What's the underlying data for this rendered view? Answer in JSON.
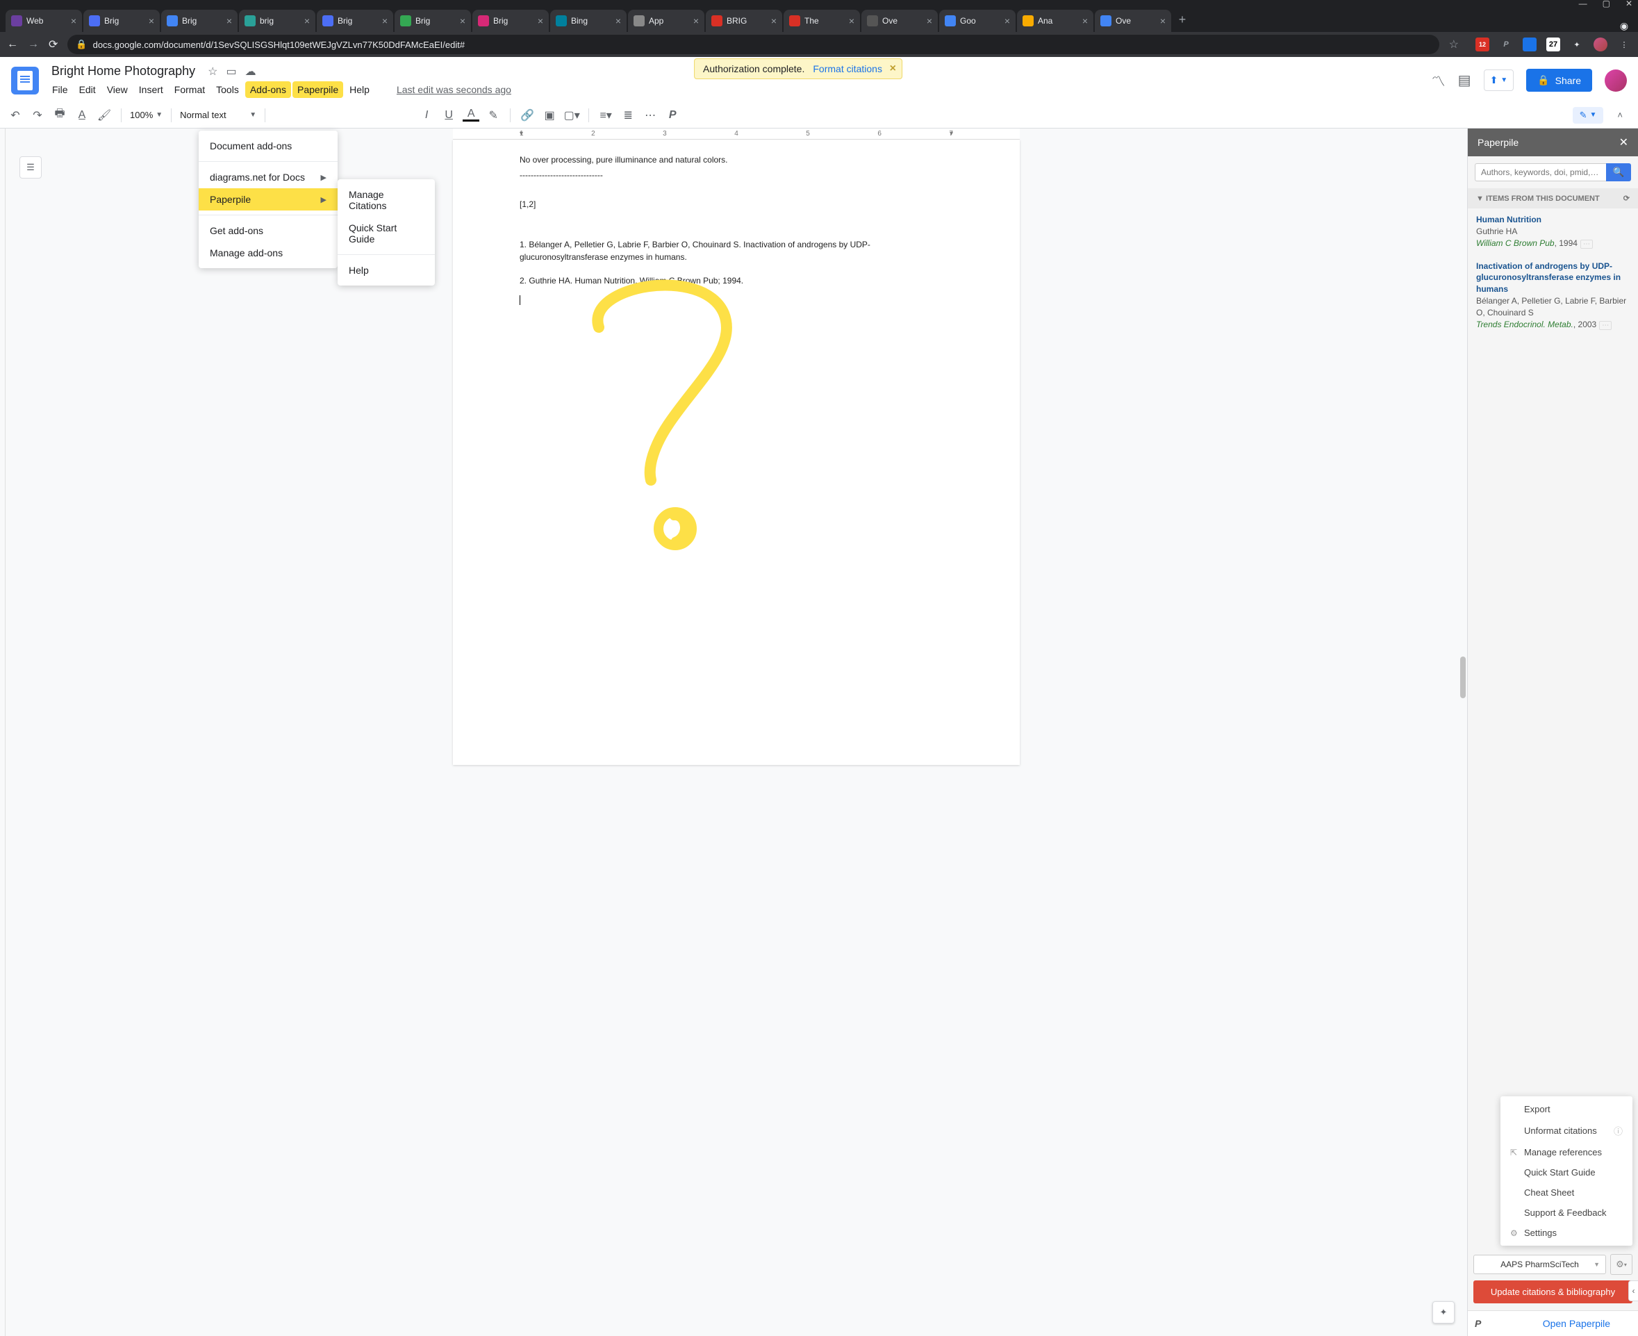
{
  "chrome": {
    "win_controls": [
      "—",
      "▢",
      "✕"
    ],
    "tabs": [
      {
        "title": "Web",
        "fav": "#6b3fa0"
      },
      {
        "title": "Brig",
        "fav": "#4c6ef5"
      },
      {
        "title": "Brig",
        "fav": "#4285f4",
        "active": true
      },
      {
        "title": "brig",
        "fav": "#2aa198"
      },
      {
        "title": "Brig",
        "fav": "#4c6ef5"
      },
      {
        "title": "Brig",
        "fav": "#34a853"
      },
      {
        "title": "Brig",
        "fav": "#d62976"
      },
      {
        "title": "Bing",
        "fav": "#00809d"
      },
      {
        "title": "App",
        "fav": "#888"
      },
      {
        "title": "BRIG",
        "fav": "#d93025"
      },
      {
        "title": "The",
        "fav": "#d93025"
      },
      {
        "title": "Ove",
        "fav": "#555"
      },
      {
        "title": "Goo",
        "fav": "#4285f4"
      },
      {
        "title": "Ana",
        "fav": "#f9ab00"
      },
      {
        "title": "Ove",
        "fav": "#4285f4"
      }
    ],
    "url": "docs.google.com/document/d/1SevSQLISGSHlqt109etWEJgVZLvn77K50DdFAMcEaEI/edit#",
    "ext_badge": "12",
    "ext_num": "27"
  },
  "docs": {
    "title": "Bright Home Photography",
    "menus": [
      "File",
      "Edit",
      "View",
      "Insert",
      "Format",
      "Tools",
      "Add-ons",
      "Paperpile",
      "Help"
    ],
    "last_edit": "Last edit was seconds ago",
    "notice_auth": "Authorization complete.",
    "notice_format": "Format citations",
    "share": "Share"
  },
  "toolbar": {
    "zoom": "100%",
    "para": "Normal text"
  },
  "ruler": [
    "1",
    "",
    "2",
    "",
    "3",
    "",
    "4",
    "",
    "5",
    "",
    "6",
    "",
    "7"
  ],
  "page": {
    "line1": "No over processing,                                                                                    pure illuminance and natural colors.",
    "sep": "------------------------------",
    "cite": "[1,2]",
    "ref1": "1. Bélanger A, Pelletier G, Labrie F, Barbier O, Chouinard S. Inactivation of androgens by UDP-glucuronosyltransferase enzymes in humans.",
    "ref2": "2. Guthrie HA. Human Nutrition. William C Brown Pub; 1994."
  },
  "addons_menu": {
    "doc_addons": "Document add-ons",
    "diagrams": "diagrams.net for Docs",
    "paperpile": "Paperpile",
    "get": "Get add-ons",
    "manage": "Manage add-ons"
  },
  "submenu": {
    "manage": "Manage Citations",
    "quick": "Quick Start Guide",
    "help": "Help"
  },
  "sidebar": {
    "title": "Paperpile",
    "search_ph": "Authors, keywords, doi, pmid,…",
    "section": "ITEMS FROM THIS DOCUMENT",
    "refs": [
      {
        "title": "Human Nutrition",
        "auth": "Guthrie HA",
        "pub": "William C Brown Pub",
        "year": ", 1994"
      },
      {
        "title": "Inactivation of androgens by UDP-glucuronosyltransferase enzymes in humans",
        "auth": "Bélanger A, Pelletier G, Labrie F, Barbier O, Chouinard S",
        "pub": "Trends Endocrinol. Metab.",
        "year": ", 2003"
      }
    ],
    "context": [
      "Export",
      "Unformat citations",
      "Manage references",
      "Quick Start Guide",
      "Cheat Sheet",
      "Support & Feedback",
      "Settings"
    ],
    "style": "AAPS PharmSciTech",
    "update": "Update citations & bibliography",
    "open": "Open Paperpile"
  }
}
